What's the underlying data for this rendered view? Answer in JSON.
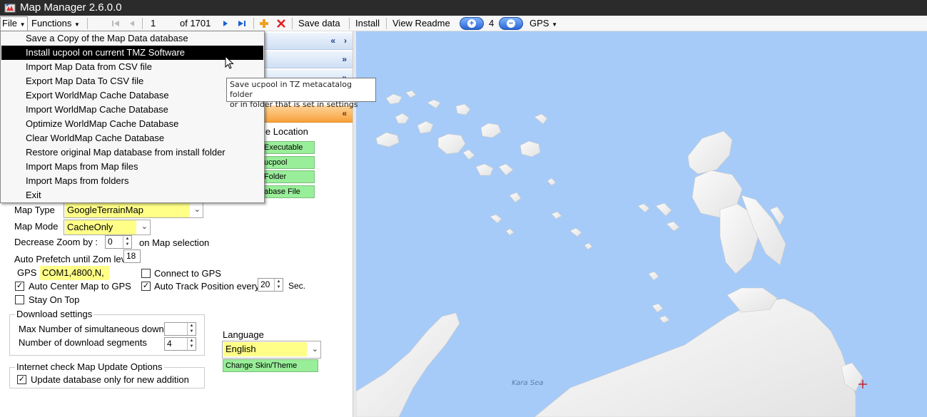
{
  "window": {
    "title": "Map Manager 2.6.0.0"
  },
  "toolbar": {
    "file": "File",
    "functions": "Functions",
    "page_value": "1",
    "page_of": "of 1701",
    "save_data": "Save data",
    "install": "Install",
    "view_readme": "View Readme",
    "zoom_level": "4",
    "gps": "GPS"
  },
  "file_menu": {
    "items": [
      "Save a Copy of the Map Data database",
      "Install ucpool on current TMZ Software",
      "Import Map Data from CSV file",
      "Export Map Data To CSV file",
      "Export WorldMap Cache Database",
      "Import WorldMap Cache Database",
      "Optimize WorldMap Cache Database",
      "Clear WorldMap Cache Database",
      "Restore original Map database from install folder",
      "Import Maps from Map files",
      "Import Maps from folders",
      "Exit"
    ],
    "highlighted_index": 1
  },
  "tooltip": {
    "line1": "Save ucpool in TZ metacatalog folder",
    "line2": "or in folder that is set in settings"
  },
  "file_location": {
    "label": "le Location",
    "executable": "Executable",
    "ucpool": "ucpool",
    "folder": "Folder",
    "database_file": "abase File"
  },
  "settings": {
    "map_type_label": "Map Type",
    "map_type_value": "GoogleTerrainMap",
    "map_mode_label": "Map Mode",
    "map_mode_value": "CacheOnly",
    "decrease_zoom_label": "Decrease Zoom by :",
    "decrease_zoom_value": "0",
    "decrease_zoom_suffix": "on Map selection",
    "auto_prefetch_label": "Auto Prefetch until Zom lev",
    "auto_prefetch_value": "18",
    "gps_label": "GPS",
    "gps_value": "COM1,4800,N,",
    "connect_gps_label": "Connect to GPS",
    "auto_center_label": "Auto Center Map to GPS",
    "auto_track_label": "Auto Track Position every",
    "auto_track_value": "20",
    "auto_track_unit": "Sec.",
    "stay_on_top_label": "Stay On Top",
    "auto_center_checked": true,
    "auto_track_checked": true,
    "connect_gps_checked": false,
    "stay_on_top_checked": false
  },
  "download": {
    "group_label": "Download settings",
    "max_label": "Max Number of simultaneous download",
    "segments_label": "Number of download segments",
    "segments_value": "4"
  },
  "language": {
    "label": "Language",
    "value": "English",
    "change_skin": "Change Skin/Theme"
  },
  "internet": {
    "group_label": "Internet check Map Update Options",
    "update_label": "Update database only for new addition",
    "update_checked": true
  },
  "map": {
    "sea_label": "Kara Sea"
  },
  "colors": {
    "water": "#a6cbf8",
    "highlight_yellow": "#ffff88",
    "green_button": "#99ee99",
    "marker": "#d00000"
  }
}
